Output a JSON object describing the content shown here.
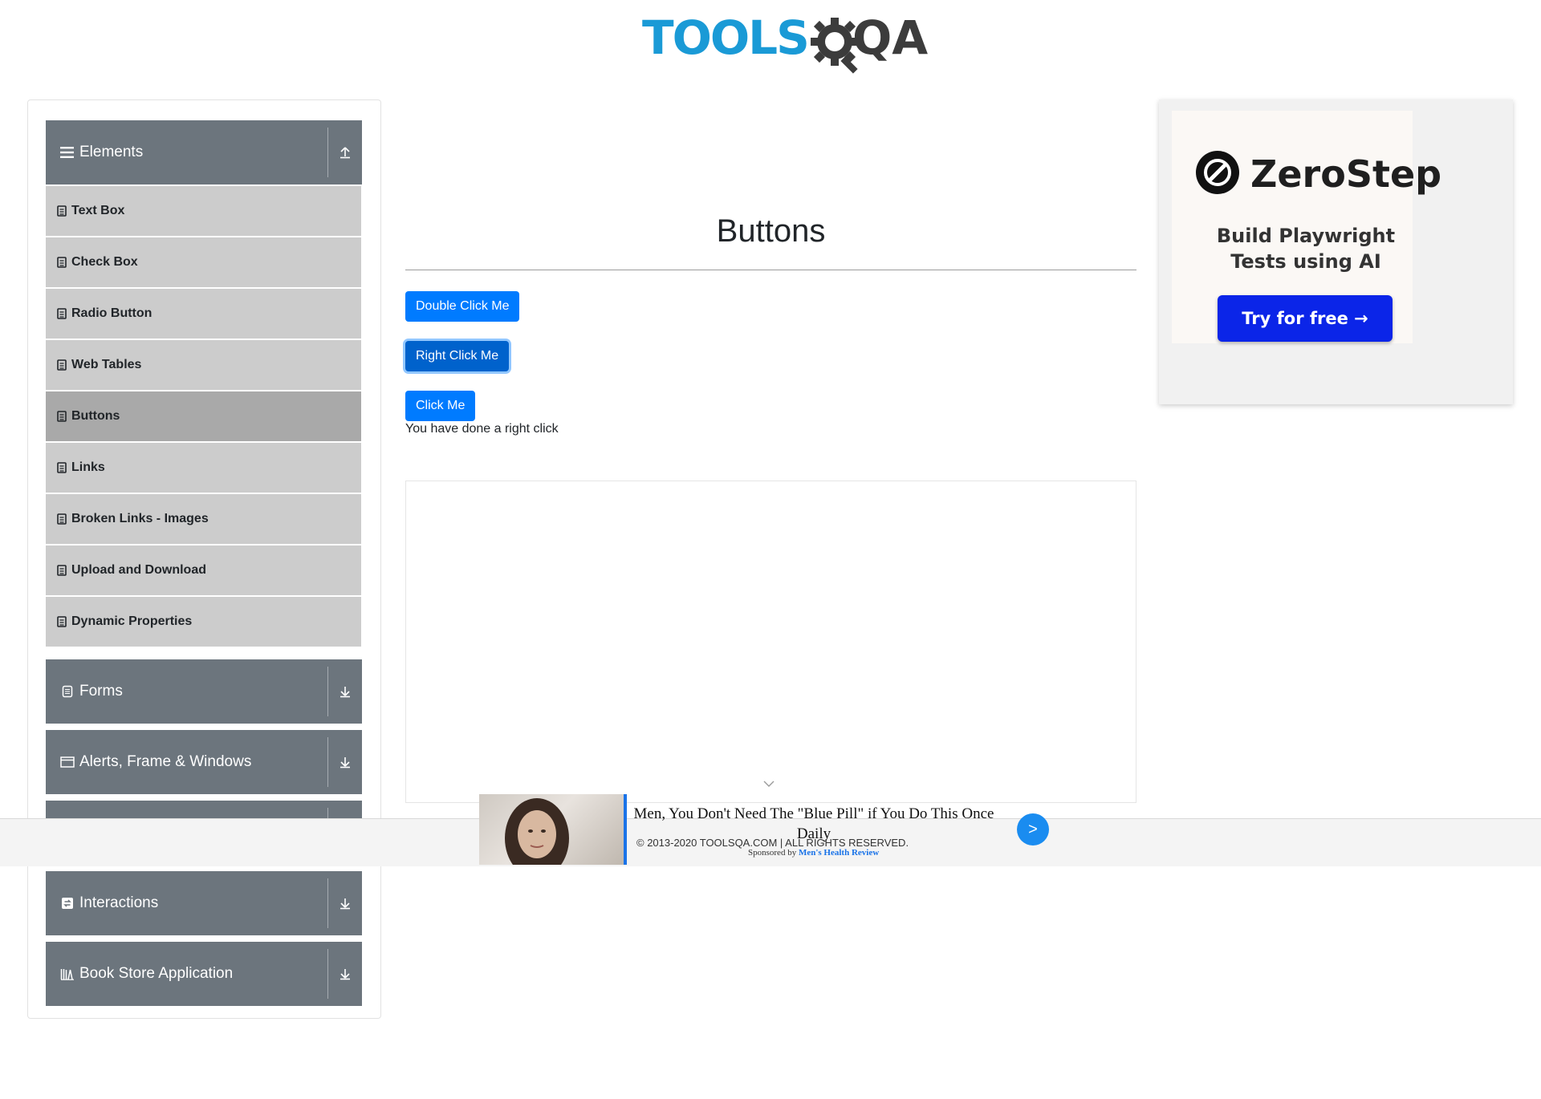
{
  "header": {
    "logo_text": "TOOLS",
    "logo_suffix": "QA"
  },
  "sidebar": {
    "groups": [
      {
        "label": "Elements",
        "icon": "menu-icon",
        "expanded": true
      },
      {
        "label": "Forms",
        "icon": "form-icon",
        "expanded": false
      },
      {
        "label": "Alerts, Frame & Windows",
        "icon": "window-icon",
        "expanded": false
      },
      {
        "label": "Interactions",
        "icon": "interactions-icon",
        "expanded": false
      },
      {
        "label": "Book Store Application",
        "icon": "books-icon",
        "expanded": false
      }
    ],
    "items": [
      {
        "label": "Text Box"
      },
      {
        "label": "Check Box"
      },
      {
        "label": "Radio Button"
      },
      {
        "label": "Web Tables"
      },
      {
        "label": "Buttons",
        "active": true
      },
      {
        "label": "Links"
      },
      {
        "label": "Broken Links - Images"
      },
      {
        "label": "Upload and Download"
      },
      {
        "label": "Dynamic Properties"
      }
    ]
  },
  "main": {
    "title": "Buttons",
    "buttons": {
      "double_click": "Double Click Me",
      "right_click": "Right Click Me",
      "click": "Click Me"
    },
    "message": "You have done a right click"
  },
  "right_ad": {
    "brand": "ZeroStep",
    "tagline_line1": "Build Playwright",
    "tagline_line2": "Tests using AI",
    "cta": "Try for free →"
  },
  "footer": {
    "copyright": "© 2013-2020 TOOLSQA.COM | ALL RIGHTS RESERVED."
  },
  "sticky_ad": {
    "headline": "Men, You Don't Need The \"Blue Pill\" if You Do This Once Daily",
    "sponsored_prefix": "Sponsored by",
    "sponsor": "Men's Health Review",
    "next_label": ">"
  },
  "colors": {
    "primary": "#007bff",
    "sidebar_header": "#6c757d",
    "sidebar_item": "#cccccc",
    "sidebar_item_active": "#a9a9a9",
    "logo_blue": "#1a9ad6"
  }
}
